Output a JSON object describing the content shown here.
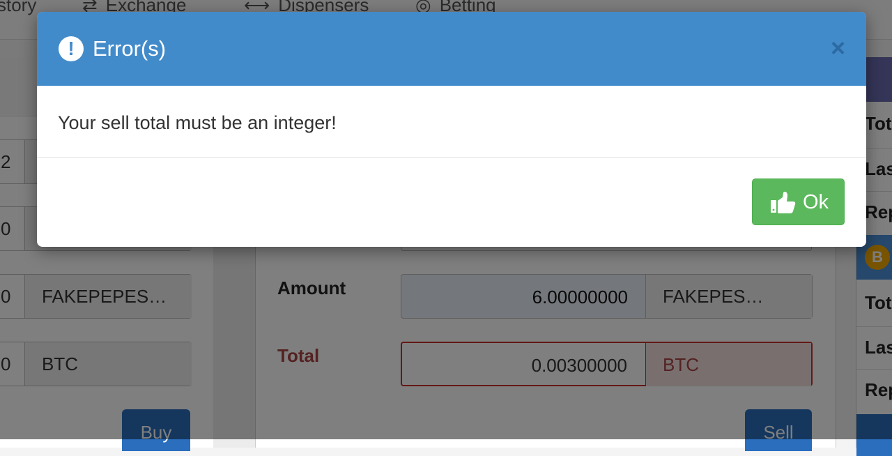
{
  "nav": {
    "items": [
      {
        "label": "story",
        "icon": ""
      },
      {
        "label": "Exchange",
        "icon": "⇄"
      },
      {
        "label": "Dispensers",
        "icon": "⟷"
      },
      {
        "label": "Betting",
        "icon": "◎"
      }
    ]
  },
  "buy_form": {
    "row1_value": "2",
    "row2_value": "0",
    "row3_value": "0",
    "row3_unit": "FAKEPEPES…",
    "row4_value": "0",
    "row4_unit": "BTC",
    "buy_label": "Buy"
  },
  "sell_form": {
    "amount_label": "Amount",
    "amount_value": "6.00000000",
    "amount_unit": "FAKEPES…",
    "total_label": "Total",
    "total_value": "0.00300000",
    "total_unit": "BTC",
    "sell_label": "Sell"
  },
  "sidebar": {
    "rows": [
      "Tot",
      "Las",
      "Rep",
      "Tot",
      "Las",
      "Rep"
    ]
  },
  "modal": {
    "title": "Error(s)",
    "icon": "exclamation-circle-icon",
    "message": "Your sell total must be an integer!",
    "close_symbol": "×",
    "ok_label": "Ok",
    "ok_icon": "thumbs-up-icon"
  },
  "colors": {
    "header": "#428bca",
    "ok_button": "#5cb85c",
    "error_text": "#a94442"
  }
}
